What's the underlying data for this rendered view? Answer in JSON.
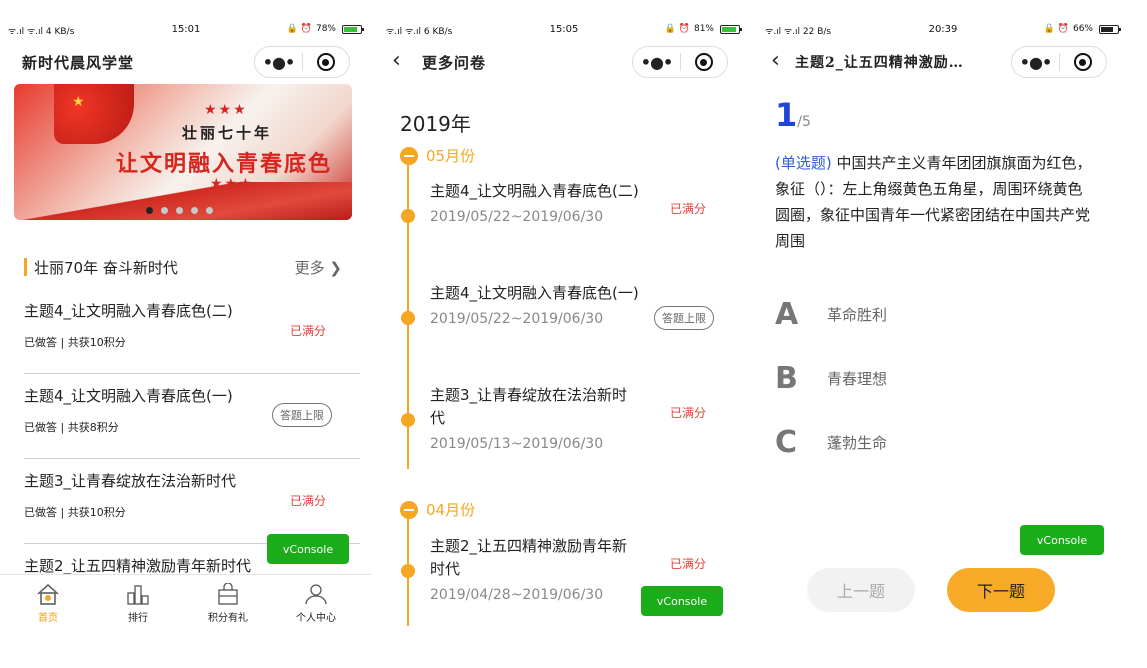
{
  "screen1": {
    "status": {
      "signal": "ᯤ.ıl ᯤ.ıl 4 KB/s",
      "time": "15:01",
      "icons": "🔒 ⏰",
      "battery": "78%",
      "battery_level": 0.78
    },
    "title": "新时代晨风学堂",
    "banner": {
      "line1": "壮丽七十年",
      "line2": "让文明融入青春底色",
      "stars": "★★★",
      "carousel_count": 5,
      "carousel_active": 0
    },
    "section": {
      "title": "壮丽70年 奋斗新时代",
      "more": "更多"
    },
    "items": [
      {
        "title": "主题4_让文明融入青春底色(二)",
        "sub": "已做答 | 共获10积分",
        "status": "已满分",
        "status_type": "red"
      },
      {
        "title": "主题4_让文明融入青春底色(一)",
        "sub": "已做答 | 共获8积分",
        "status": "答题上限",
        "status_type": "pill"
      },
      {
        "title": "主题3_让青春绽放在法治新时代",
        "sub": "已做答 | 共获10积分",
        "status": "已满分",
        "status_type": "red"
      },
      {
        "title": "主题2_让五四精神激励青年新时代",
        "sub": "",
        "status": "",
        "status_type": "none"
      }
    ],
    "tabs": [
      {
        "label": "首页",
        "icon": "home-icon",
        "active": true
      },
      {
        "label": "排行",
        "icon": "ranking-icon",
        "active": false
      },
      {
        "label": "积分有礼",
        "icon": "gift-bag-icon",
        "active": false
      },
      {
        "label": "个人中心",
        "icon": "user-icon",
        "active": false
      }
    ],
    "vconsole": "vConsole"
  },
  "screen2": {
    "status": {
      "signal": "ᯤ.ıl ᯤ.ıl 6 KB/s",
      "time": "15:05",
      "icons": "🔒 ⏰",
      "battery": "81%",
      "battery_level": 0.81
    },
    "title": "更多问卷",
    "year": "2019年",
    "groups": [
      {
        "month": "05月份",
        "entries": [
          {
            "title": "主题4_让文明融入青春底色(二)",
            "date": "2019/05/22~2019/06/30",
            "status": "已满分",
            "status_type": "red"
          },
          {
            "title": "主题4_让文明融入青春底色(一)",
            "date": "2019/05/22~2019/06/30",
            "status": "答题上限",
            "status_type": "pill"
          },
          {
            "title": "主题3_让青春绽放在法治新时代",
            "date": "2019/05/13~2019/06/30",
            "status": "已满分",
            "status_type": "red"
          }
        ]
      },
      {
        "month": "04月份",
        "entries": [
          {
            "title": "主题2_让五四精神激励青年新时代",
            "date": "2019/04/28~2019/06/30",
            "status": "已满分",
            "status_type": "red"
          }
        ]
      }
    ],
    "vconsole": "vConsole"
  },
  "screen3": {
    "status": {
      "signal": "ᯤ.ıl ᯤ.ıl 22 B/s",
      "time": "20:39",
      "icons": "🔒 ⏰",
      "battery": "66%",
      "battery_level": 0.66
    },
    "title": "主题2_让五四精神激励…",
    "question_index": "1",
    "question_total": "/5",
    "question_type": "(单选题)",
    "question_text": "中国共产主义青年团团旗旗面为红色，象征（）：左上角缀黄色五角星，周围环绕黄色圆圈，象征中国青年一代紧密团结在中国共产党周围",
    "options": [
      {
        "key": "A",
        "text": "革命胜利"
      },
      {
        "key": "B",
        "text": "青春理想"
      },
      {
        "key": "C",
        "text": "蓬勃生命"
      }
    ],
    "prev": "上一题",
    "next": "下一题",
    "vconsole": "vConsole"
  }
}
